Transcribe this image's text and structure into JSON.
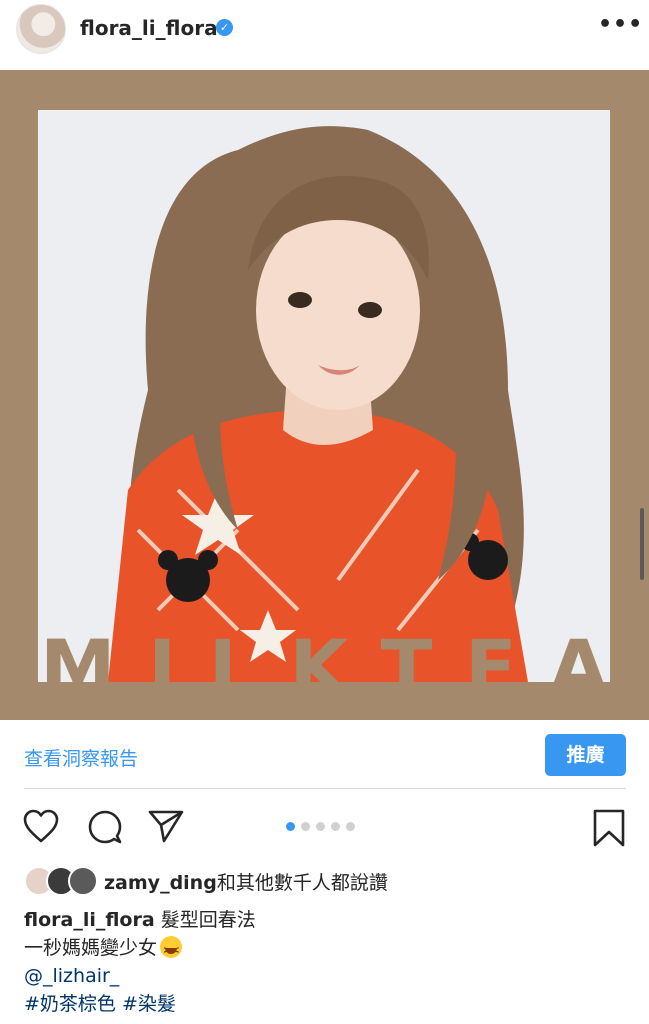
{
  "header": {
    "username": "flora_li_flora",
    "verified_icon": "verified-badge-icon",
    "more_label": "•••"
  },
  "post": {
    "overlay_letters": [
      "M",
      "I",
      "L",
      "K",
      "T",
      "E",
      "A"
    ],
    "carousel": {
      "count": 5,
      "active_index": 0
    }
  },
  "actions": {
    "insights_label": "查看洞察報告",
    "promote_label": "推廣",
    "icons": [
      "heart-icon",
      "comment-icon",
      "share-icon",
      "bookmark-icon"
    ]
  },
  "likes": {
    "username": "zamy_ding",
    "text": "和其他數千人都說讚"
  },
  "caption": {
    "username": "flora_li_flora",
    "line1": "髮型回春法",
    "line2": "一秒媽媽變少女",
    "mention": "@_lizhair_",
    "hashtags": "#奶茶棕色 #染髮"
  },
  "colors": {
    "accent": "#3897f0",
    "frame": "#a5896d"
  }
}
